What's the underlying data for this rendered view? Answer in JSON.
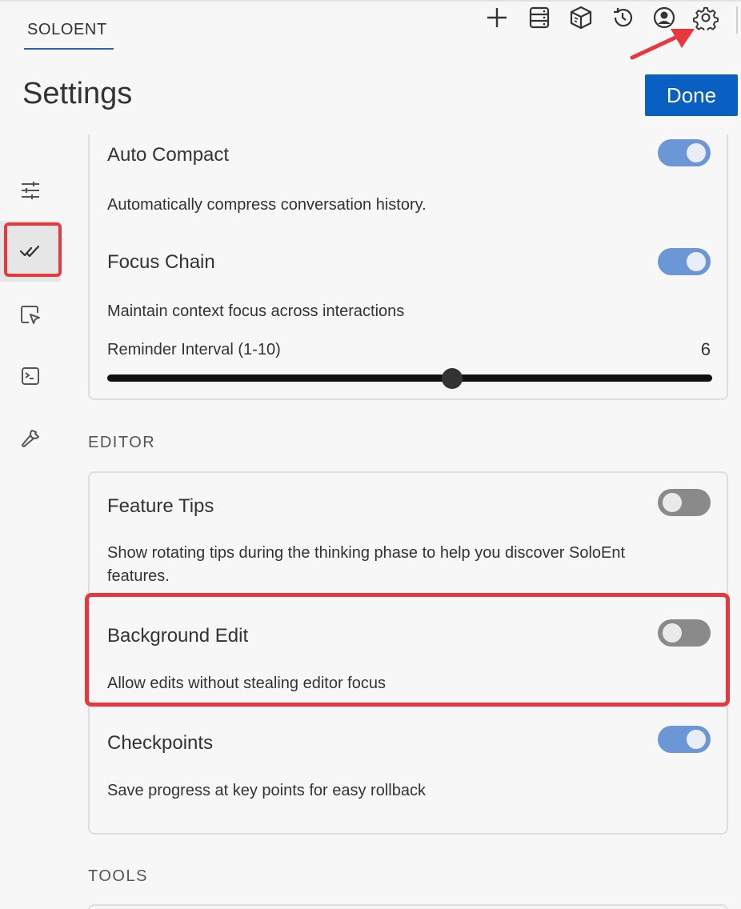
{
  "header": {
    "brand": "SOLOENT",
    "icons": [
      "plus-icon",
      "server-icon",
      "package-icon",
      "history-icon",
      "account-icon",
      "gear-icon"
    ]
  },
  "page": {
    "title": "Settings",
    "done_label": "Done"
  },
  "sidebar": {
    "items": [
      {
        "icon": "sliders-icon",
        "active": false
      },
      {
        "icon": "double-check-icon",
        "active": true
      },
      {
        "icon": "browser-cursor-icon",
        "active": false
      },
      {
        "icon": "terminal-icon",
        "active": false
      },
      {
        "icon": "wrench-icon",
        "active": false
      }
    ]
  },
  "features": {
    "auto_compact": {
      "title": "Auto Compact",
      "description": "Automatically compress conversation history.",
      "enabled": true
    },
    "focus_chain": {
      "title": "Focus Chain",
      "description": "Maintain context focus across interactions",
      "enabled": true,
      "slider_label": "Reminder Interval (1-10)",
      "slider_value": "6",
      "slider_min": 1,
      "slider_max": 10,
      "slider_level": 6
    }
  },
  "editor": {
    "heading": "EDITOR",
    "feature_tips": {
      "title": "Feature Tips",
      "description": "Show rotating tips during the thinking phase to help you discover SoloEnt features.",
      "enabled": false
    },
    "background_edit": {
      "title": "Background Edit",
      "description": "Allow edits without stealing editor focus",
      "enabled": false
    },
    "checkpoints": {
      "title": "Checkpoints",
      "description": "Save progress at key points for easy rollback",
      "enabled": true
    }
  },
  "tools": {
    "heading": "TOOLS"
  },
  "colors": {
    "accent": "#0a60c2",
    "toggle_on": "#6b97d6",
    "toggle_off": "#8a8a8a",
    "annotation": "#e8373d"
  }
}
